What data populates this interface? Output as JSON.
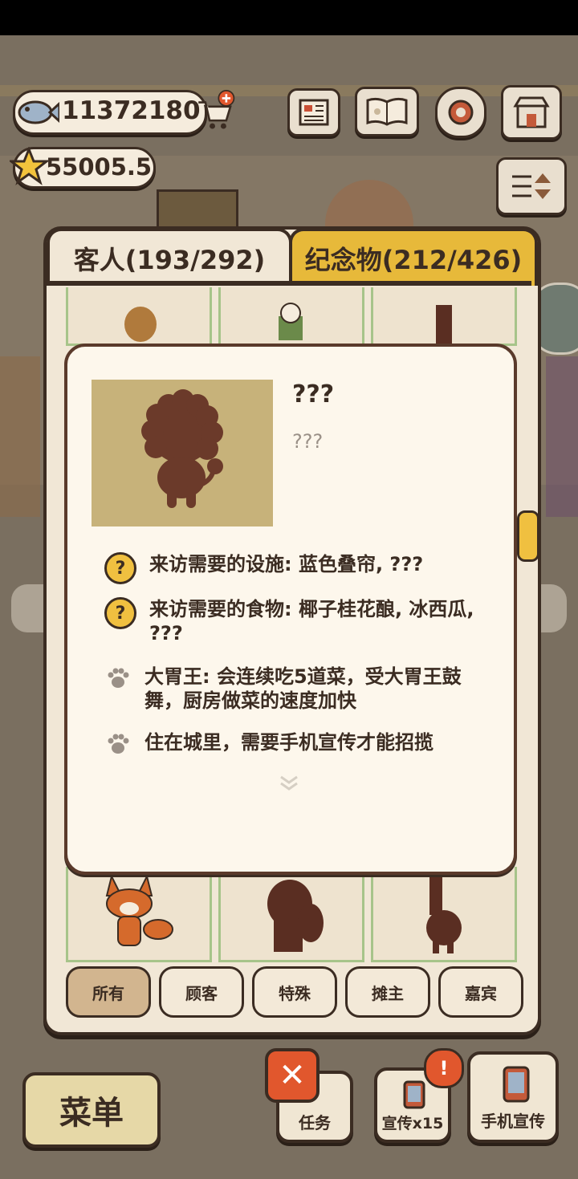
{
  "hud": {
    "fish_currency": "11372180",
    "star_currency": "55005.5"
  },
  "tabs": {
    "guests": "客人(193/292)",
    "souvenirs": "纪念物(212/426)"
  },
  "detail": {
    "name": "???",
    "description": "???",
    "rows": [
      {
        "icon": "question-icon",
        "text": "来访需要的设施: 蓝色叠帘, ???"
      },
      {
        "icon": "question-icon",
        "text": "来访需要的食物: 椰子桂花酿, 冰西瓜, ???"
      },
      {
        "icon": "paw-icon",
        "text": "大胃王: 会连续吃5道菜，受大胃王鼓舞，厨房做菜的速度加快"
      },
      {
        "icon": "paw-icon",
        "text": "住在城里，需要手机宣传才能招揽"
      }
    ]
  },
  "filters": [
    "所有",
    "顾客",
    "特殊",
    "摊主",
    "嘉宾"
  ],
  "bottom": {
    "menu": "菜单",
    "tasks": "任务",
    "promote_x15": "宣传x15",
    "phone_promote": "手机宣传",
    "close": "✕"
  },
  "colors": {
    "accent_tab": "#e7b93a",
    "card_border": "#5a3a2b",
    "close_button": "#e1572d"
  }
}
